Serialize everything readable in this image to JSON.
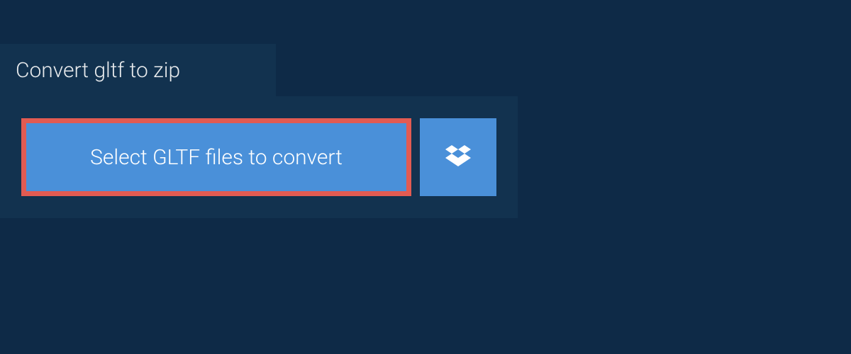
{
  "tab": {
    "label": "Convert gltf to zip"
  },
  "actions": {
    "select_files_label": "Select GLTF files to convert",
    "dropbox_icon": "dropbox"
  }
}
